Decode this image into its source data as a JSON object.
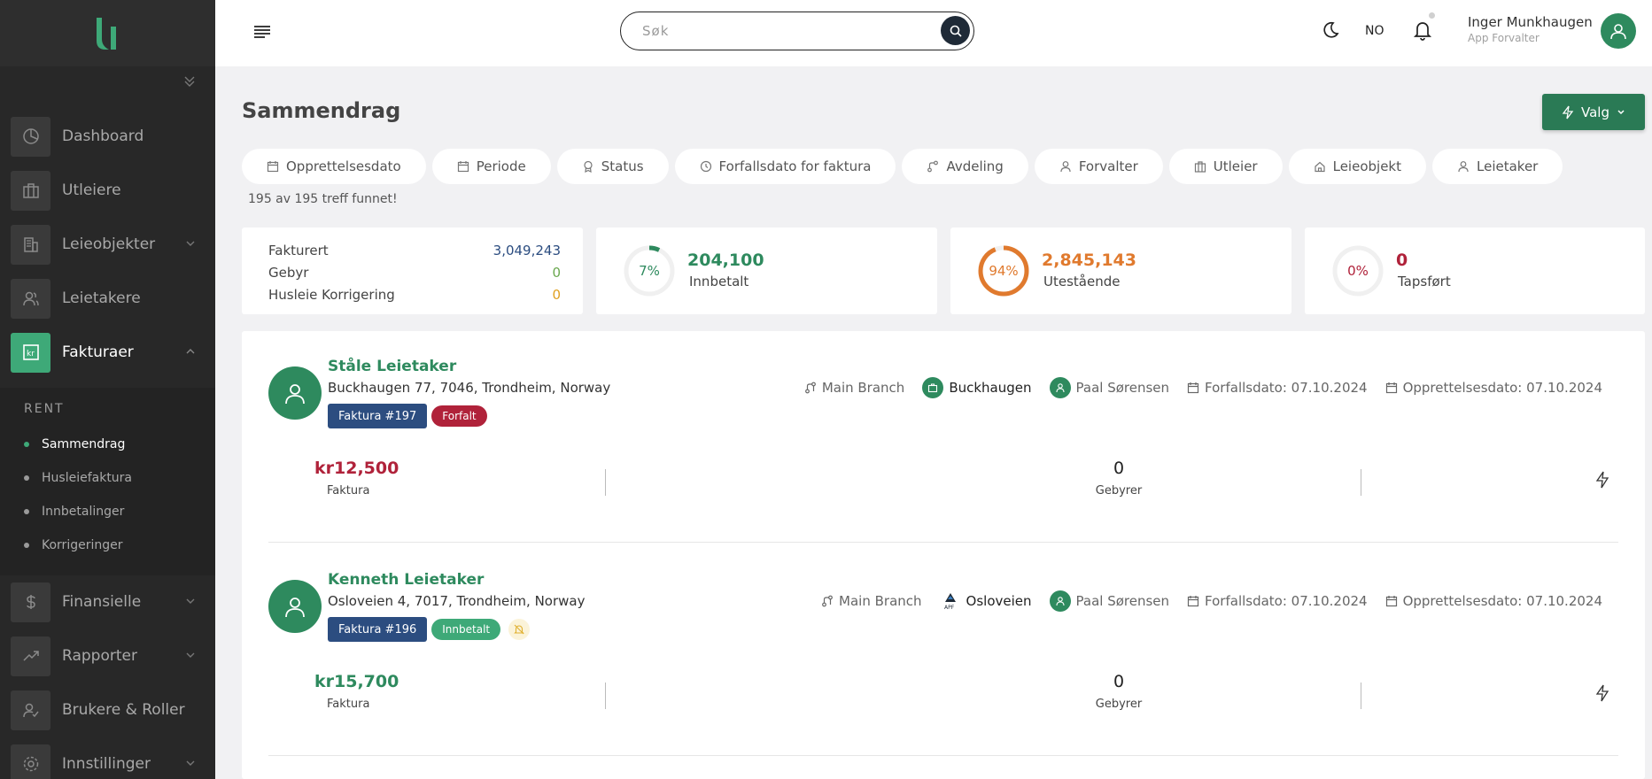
{
  "brand": {
    "accent": "#3ea978",
    "primary_dark": "#2a7a55",
    "sidebar_bg": "#282828"
  },
  "sidebar": {
    "logo": "u",
    "items": [
      {
        "label": "Dashboard",
        "icon": "pie-chart-icon"
      },
      {
        "label": "Utleiere",
        "icon": "building-icon"
      },
      {
        "label": "Leieobjekter",
        "icon": "buildings-icon"
      },
      {
        "label": "Leietakere",
        "icon": "users-icon"
      },
      {
        "label": "Fakturaer",
        "icon": "invoice-icon"
      },
      {
        "label": "Finansielle",
        "icon": "dollar-icon"
      },
      {
        "label": "Rapporter",
        "icon": "trend-icon"
      },
      {
        "label": "Brukere & Roller",
        "icon": "user-check-icon"
      },
      {
        "label": "Innstillinger",
        "icon": "gear-icon"
      }
    ],
    "submenu_title": "RENT",
    "submenu": [
      "Sammendrag",
      "Husleiefaktura",
      "Innbetalinger",
      "Korrigeringer"
    ]
  },
  "header": {
    "search_placeholder": "Søk",
    "language": "NO",
    "user_name": "Inger Munkhaugen",
    "user_role": "App Forvalter"
  },
  "page": {
    "title": "Sammendrag",
    "valg_label": "Valg",
    "filters": [
      "Opprettelsesdato",
      "Periode",
      "Status",
      "Forfallsdato for faktura",
      "Avdeling",
      "Forvalter",
      "Utleier",
      "Leieobjekt",
      "Leietaker"
    ],
    "result_count": "195 av 195 treff funnet!"
  },
  "stats": {
    "summary": [
      {
        "label": "Fakturert",
        "value": "3,049,243",
        "color": "#2c4d80"
      },
      {
        "label": "Gebyr",
        "value": "0",
        "color": "#6aa84f"
      },
      {
        "label": "Husleie Korrigering",
        "value": "0",
        "color": "#e0a020"
      }
    ],
    "rings": [
      {
        "percent_text": "7%",
        "percent": 7,
        "value": "204,100",
        "label": "Innbetalt",
        "color": "#2e8a5e"
      },
      {
        "percent_text": "94%",
        "percent": 94,
        "value": "2,845,143",
        "label": "Utestående",
        "color": "#e07a2e"
      },
      {
        "percent_text": "0%",
        "percent": 0,
        "value": "0",
        "label": "Tapsført",
        "color": "#b0223a"
      }
    ]
  },
  "invoices": [
    {
      "name": "Ståle Leietaker",
      "address": "Buckhaugen 77, 7046, Trondheim, Norway",
      "invoice_no": "Faktura #197",
      "status": "Forfalt",
      "status_color": "#b0223a",
      "branch": "Main Branch",
      "location": "Buckhaugen",
      "manager": "Paal Sørensen",
      "due": "Forfallsdato: 07.10.2024",
      "created": "Opprettelsesdato: 07.10.2024",
      "amount": "kr12,500",
      "amount_color": "#b0223a",
      "amount_label": "Faktura",
      "fees": "0",
      "fees_label": "Gebyrer"
    },
    {
      "name": "Kenneth Leietaker",
      "address": "Osloveien 4, 7017, Trondheim, Norway",
      "invoice_no": "Faktura #196",
      "status": "Innbetalt",
      "status_color": "#3ea978",
      "branch": "Main Branch",
      "location": "Osloveien",
      "manager": "Paal Sørensen",
      "due": "Forfallsdato: 07.10.2024",
      "created": "Opprettelsesdato: 07.10.2024",
      "amount": "kr15,700",
      "amount_color": "#2e8a5e",
      "amount_label": "Faktura",
      "fees": "0",
      "fees_label": "Gebyrer"
    }
  ]
}
